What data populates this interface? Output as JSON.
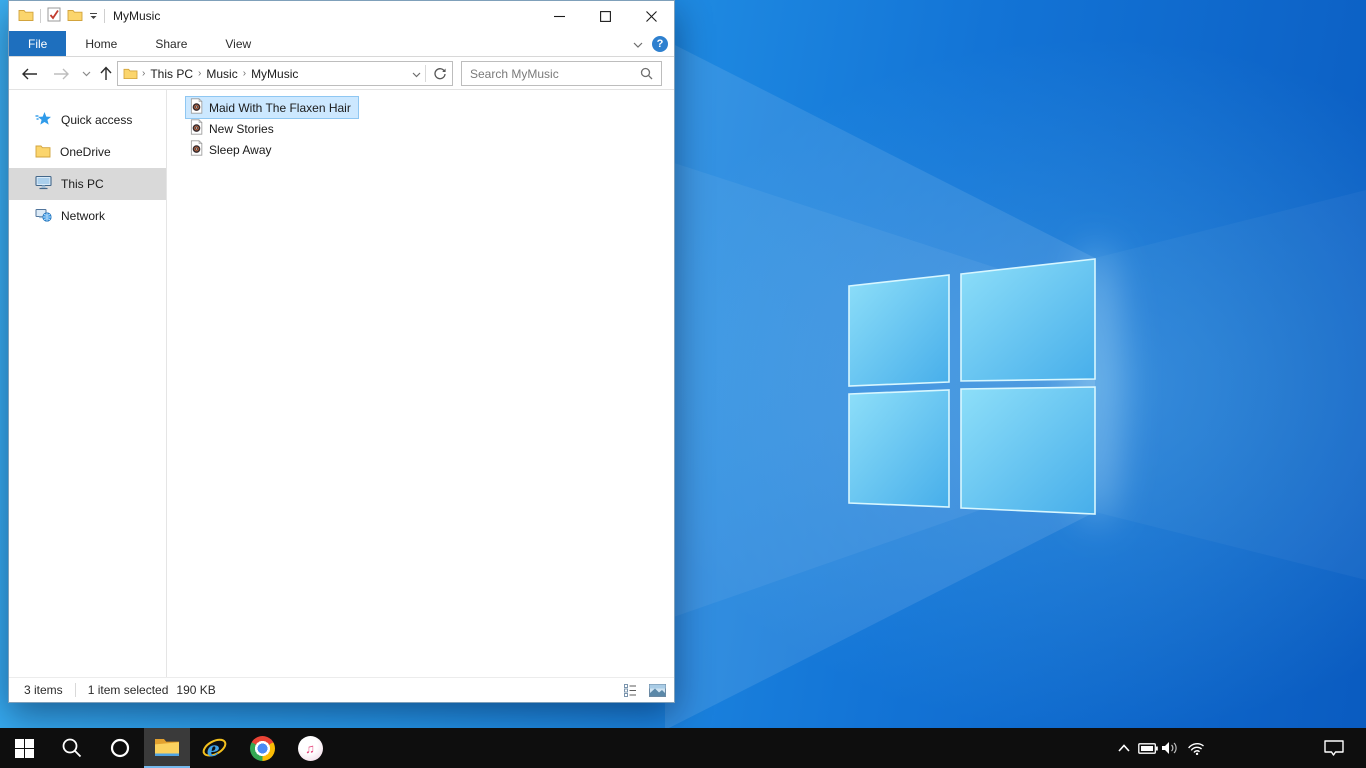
{
  "explorer": {
    "titlebar": {
      "title": "MyMusic",
      "quick_access_icons": [
        "folder-window-icon",
        "properties-icon",
        "new-folder-icon",
        "customize-toolbar-chevron-icon"
      ],
      "window_controls": [
        "minimize",
        "maximize",
        "close"
      ]
    },
    "ribbon_tabs": [
      {
        "label": "File",
        "active": true
      },
      {
        "label": "Home",
        "active": false
      },
      {
        "label": "Share",
        "active": false
      },
      {
        "label": "View",
        "active": false
      }
    ],
    "ribbon_right_icons": [
      "expand-ribbon-chevron-icon",
      "help-icon"
    ],
    "navbar": {
      "nav_icons": [
        "back-icon",
        "forward-icon",
        "recent-locations-chevron-icon",
        "up-icon"
      ],
      "breadcrumb": [
        "This PC",
        "Music",
        "MyMusic"
      ],
      "address_icons": [
        "folder-icon",
        "address-dropdown-chevron-icon",
        "refresh-icon"
      ],
      "search_placeholder": "Search MyMusic",
      "search_icon": "magnifier-icon"
    },
    "sidebar": [
      {
        "label": "Quick access",
        "icon": "quick-access-star-icon",
        "selected": false
      },
      {
        "label": "OneDrive",
        "icon": "onedrive-folder-icon",
        "selected": false
      },
      {
        "label": "This PC",
        "icon": "this-pc-monitor-icon",
        "selected": true
      },
      {
        "label": "Network",
        "icon": "network-icon",
        "selected": false
      }
    ],
    "files": [
      {
        "name": "Maid With The Flaxen Hair",
        "icon": "audio-file-icon",
        "selected": true
      },
      {
        "name": "New Stories",
        "icon": "audio-file-icon",
        "selected": false
      },
      {
        "name": "Sleep Away",
        "icon": "audio-file-icon",
        "selected": false
      }
    ],
    "statusbar": {
      "count": "3 items",
      "selection": "1 item selected",
      "size": "190 KB",
      "view_icons": [
        "details-view-icon",
        "large-thumbnails-view-icon"
      ]
    }
  },
  "taskbar": {
    "buttons": [
      "start",
      "search",
      "cortana",
      "file-explorer",
      "internet-explorer",
      "chrome",
      "itunes"
    ],
    "active_button": "file-explorer",
    "tray": [
      "show-hidden-icons-chevron",
      "battery",
      "volume",
      "wifi",
      "action-center"
    ]
  },
  "colors": {
    "file_tab_blue": "#1e6fbe",
    "selection_bg": "#cce8ff",
    "selection_border": "#8fc7f2",
    "sidebar_selected_bg": "#d9d9d9",
    "taskbar_bg": "#0e0e0e",
    "taskbar_active_bg": "#3a3a3a",
    "taskbar_active_underline": "#76b9ed",
    "wallpaper_light": "#3cb1f2",
    "wallpaper_dark": "#0a5bc0"
  }
}
